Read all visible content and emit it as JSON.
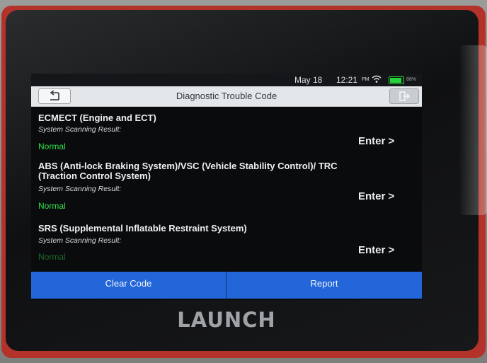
{
  "device": {
    "brand": "LAUNCH"
  },
  "status_bar": {
    "date": "May 18",
    "time": "12:21",
    "ampm": "PM",
    "battery_percent": "88%"
  },
  "header": {
    "title": "Diagnostic Trouble Code"
  },
  "systems": [
    {
      "name": "ECMECT (Engine and ECT)",
      "scan_label": "System Scanning Result:",
      "result": "Normal",
      "action": "Enter >"
    },
    {
      "name": "ABS (Anti-lock Braking System)/VSC (Vehicle Stability Control)/ TRC (Traction Control System)",
      "scan_label": "System Scanning Result:",
      "result": "Normal",
      "action": "Enter >"
    },
    {
      "name": "SRS (Supplemental Inflatable Restraint System)",
      "scan_label": "System Scanning Result:",
      "result": "Normal",
      "action": "Enter >"
    }
  ],
  "footer": {
    "clear_label": "Clear Code",
    "report_label": "Report"
  },
  "colors": {
    "accent": "#2266d9",
    "result_ok": "#2fe24a",
    "title_bar": "#e4e7ea",
    "device_shell": "#b3322a"
  },
  "icons": {
    "back": "back-arrow-icon",
    "exit": "exit-icon",
    "wifi": "wifi-icon",
    "battery": "battery-icon"
  }
}
